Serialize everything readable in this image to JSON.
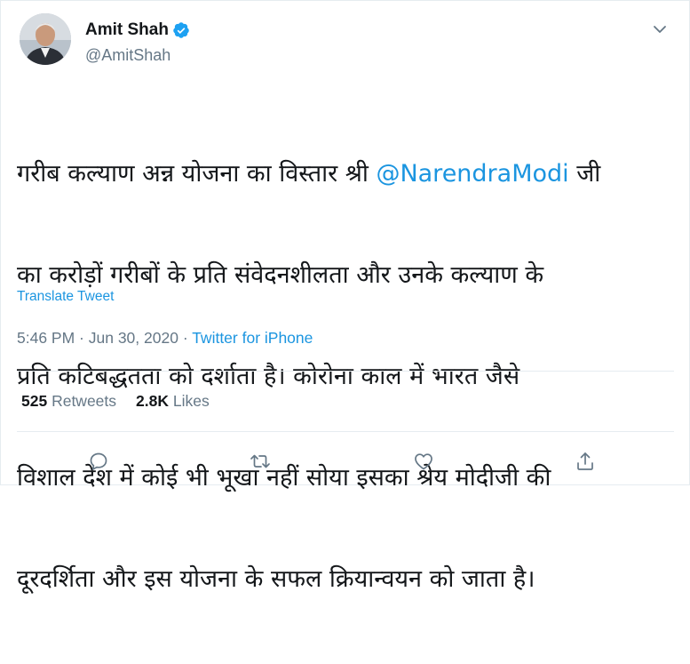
{
  "author": {
    "name": "Amit Shah",
    "handle": "@AmitShah"
  },
  "tweet": {
    "line1_pre": "गरीब कल्याण अन्न योजना का विस्तार श्री ",
    "mention": "@NarendraModi",
    "line1_post": " जी",
    "line2": "का करोड़ों गरीबों के प्रति संवेदनशीलता और उनके कल्याण के",
    "line3": "प्रति कटिबद्धतता को दर्शाता है। कोरोना काल में भारत जैसे",
    "line4": "विशाल देश में कोई भी भूखा नहीं सोया इसका श्रेय मोदीजी की",
    "line5": "दूरदर्शिता और इस योजना के सफल क्रियान्वयन को जाता है।"
  },
  "translate_label": "Translate Tweet",
  "meta": {
    "time": "5:46 PM",
    "separator": " · ",
    "date": "Jun 30, 2020",
    "source": "Twitter for iPhone"
  },
  "stats": {
    "retweets_count": "525",
    "retweets_label": "Retweets",
    "likes_count": "2.8K",
    "likes_label": "Likes"
  },
  "colors": {
    "accent": "#1b95e0",
    "secondary_text": "#657786",
    "primary_text": "#14171a",
    "divider": "#e6ecf0"
  },
  "icons": {
    "reply": "reply-icon",
    "retweet": "retweet-icon",
    "like": "like-icon",
    "share": "share-icon",
    "verified": "verified-badge-icon",
    "more": "chevron-down-icon"
  }
}
